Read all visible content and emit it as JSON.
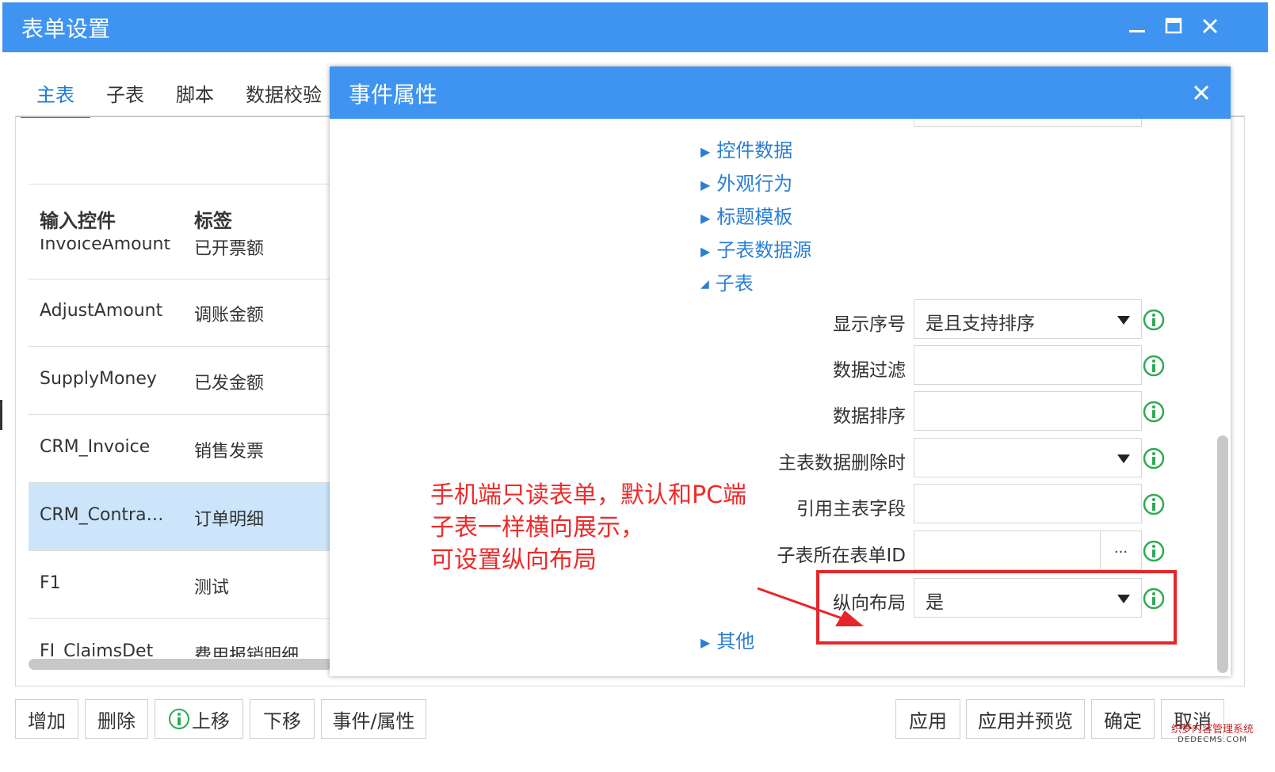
{
  "window": {
    "title": "表单设置"
  },
  "tabs": [
    {
      "label": "主表"
    },
    {
      "label": "子表"
    },
    {
      "label": "脚本"
    },
    {
      "label": "数据校验"
    }
  ],
  "grid": {
    "headers": {
      "control": "输入控件",
      "label": "标签"
    },
    "rows": [
      {
        "control": "InvoiceAmount",
        "label": "已开票额"
      },
      {
        "control": "AdjustAmount",
        "label": "调账金额"
      },
      {
        "control": "SupplyMoney",
        "label": "已发金额"
      },
      {
        "control": "CRM_Invoice",
        "label": "销售发票"
      },
      {
        "control": "CRM_Contra…",
        "label": "订单明细"
      },
      {
        "control": "F1",
        "label": "测试"
      },
      {
        "control": "FI_ClaimsDet",
        "label": "费用报销明细"
      }
    ]
  },
  "bottom_buttons": {
    "add": "增加",
    "delete": "删除",
    "move_up": "上移",
    "move_down": "下移",
    "events": "事件/属性",
    "apply": "应用",
    "apply_preview": "应用并预览",
    "ok": "确定",
    "cancel": "取消"
  },
  "dialog": {
    "title": "事件属性",
    "sections": [
      {
        "label": "控件数据",
        "expanded": false
      },
      {
        "label": "外观行为",
        "expanded": false
      },
      {
        "label": "标题模板",
        "expanded": false
      },
      {
        "label": "子表数据源",
        "expanded": false
      },
      {
        "label": "子表",
        "expanded": true
      },
      {
        "label": "其他",
        "expanded": false
      }
    ],
    "properties": [
      {
        "label": "显示序号",
        "value": "是且支持排序",
        "type": "select"
      },
      {
        "label": "数据过滤",
        "value": "",
        "type": "text"
      },
      {
        "label": "数据排序",
        "value": "",
        "type": "text"
      },
      {
        "label": "主表数据删除时",
        "value": "",
        "type": "select"
      },
      {
        "label": "引用主表字段",
        "value": "",
        "type": "text"
      },
      {
        "label": "子表所在表单ID",
        "value": "",
        "type": "picker",
        "picker_label": "..."
      },
      {
        "label": "纵向布局",
        "value": "是",
        "type": "select"
      }
    ]
  },
  "annotation": {
    "lines": [
      "手机端只读表单，默认和PC端",
      "子表一样横向展示，",
      "可设置纵向布局"
    ],
    "color": "#ee2b2b"
  },
  "watermark": {
    "line1": "织梦内容管理系统",
    "line2": "DEDECMS.COM"
  },
  "colors": {
    "accent": "#3e94f0",
    "link": "#2a7fd4",
    "selected_row": "#cce5fb",
    "info_icon": "#2eaa55"
  }
}
